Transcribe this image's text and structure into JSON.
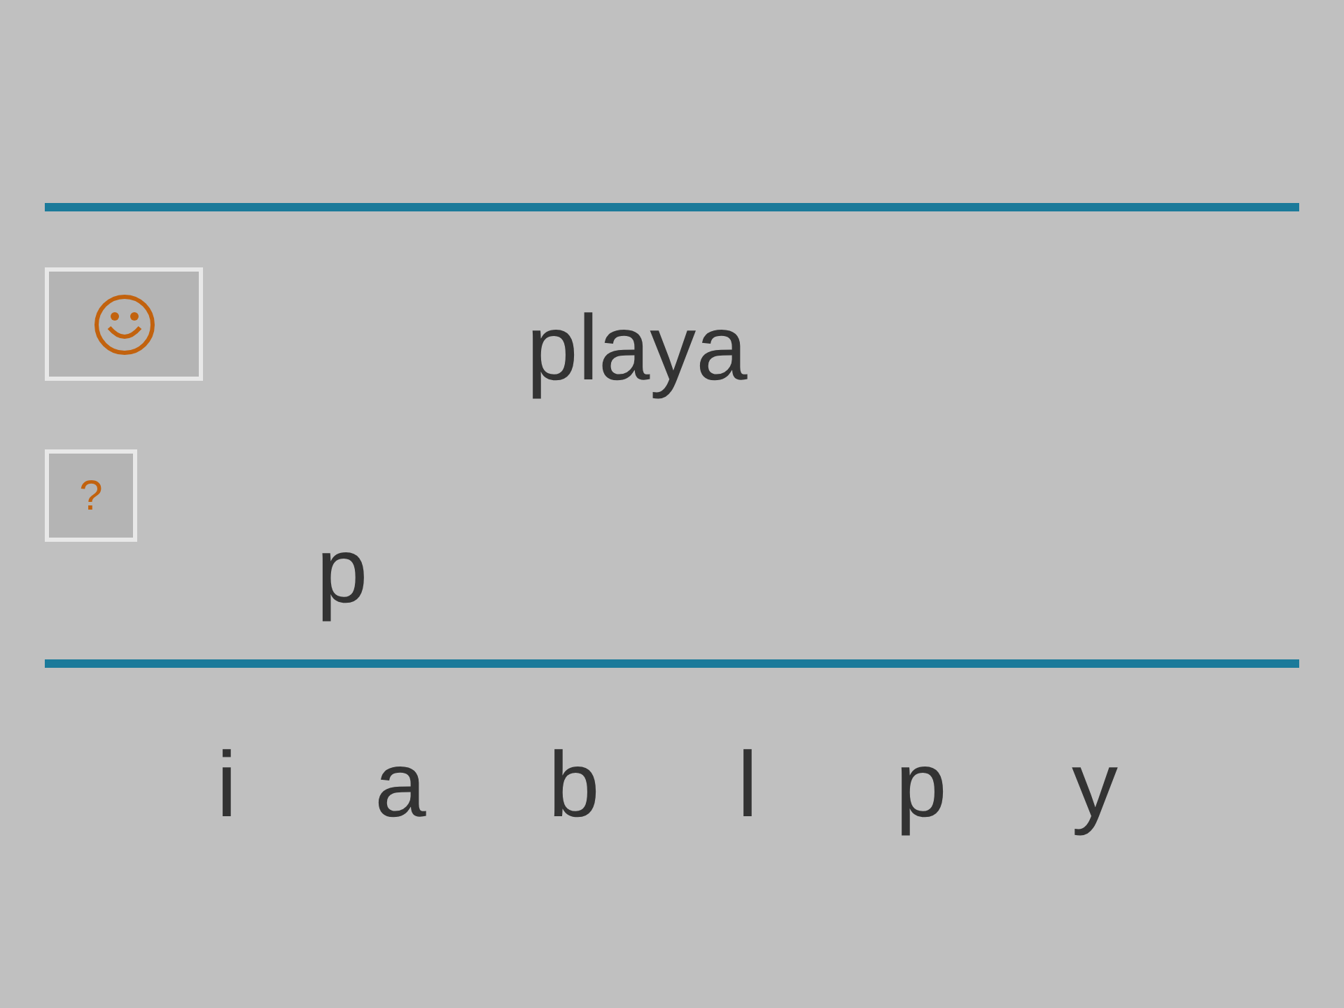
{
  "word": "playa",
  "help_button": {
    "label": "?"
  },
  "answer": "p",
  "letters": [
    "i",
    "a",
    "b",
    "l",
    "p",
    "y"
  ]
}
